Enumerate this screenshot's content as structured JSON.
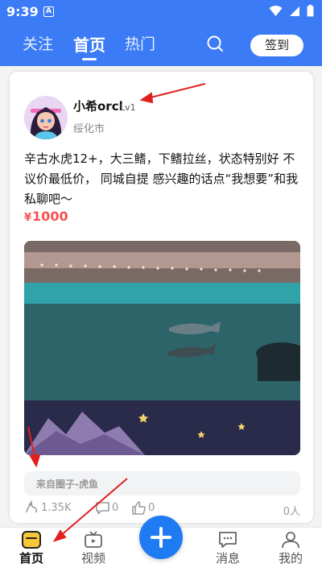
{
  "status_bar": {
    "time": "9:39",
    "notification_badge": "A"
  },
  "top_nav": {
    "tabs": [
      {
        "label": "关注",
        "active": false
      },
      {
        "label": "首页",
        "active": true
      },
      {
        "label": "热门",
        "active": false
      }
    ],
    "search_icon": "search-icon",
    "signin_label": "签到"
  },
  "post": {
    "user": {
      "name": "小希orcl",
      "level": "Lv1",
      "city": "绥化市"
    },
    "text": "辛古水虎12+，大三鳍，下鳍拉丝，状态特别好 不议价最低价， 同城自提 感兴趣的话点“我想要”和我私聊吧～",
    "price_symbol": "¥",
    "price": "1000",
    "circle_tag": "来自圈子-虎鱼",
    "stats": {
      "likes_hot": "1.35K",
      "comments": "0",
      "thumbs": "0",
      "viewers": "0人"
    }
  },
  "bottom_nav": {
    "items": [
      {
        "label": "首页",
        "icon": "home-icon",
        "active": true
      },
      {
        "label": "视频",
        "icon": "tv-icon",
        "active": false
      },
      {
        "label": "消息",
        "icon": "message-icon",
        "active": false
      },
      {
        "label": "我的",
        "icon": "profile-icon",
        "active": false
      }
    ],
    "fab_icon": "plus-icon"
  },
  "colors": {
    "brand_blue": "#3b7bf6",
    "price_red": "#f4524f",
    "fab_blue": "#1f7bf2",
    "annotation_red": "#e0201f"
  }
}
